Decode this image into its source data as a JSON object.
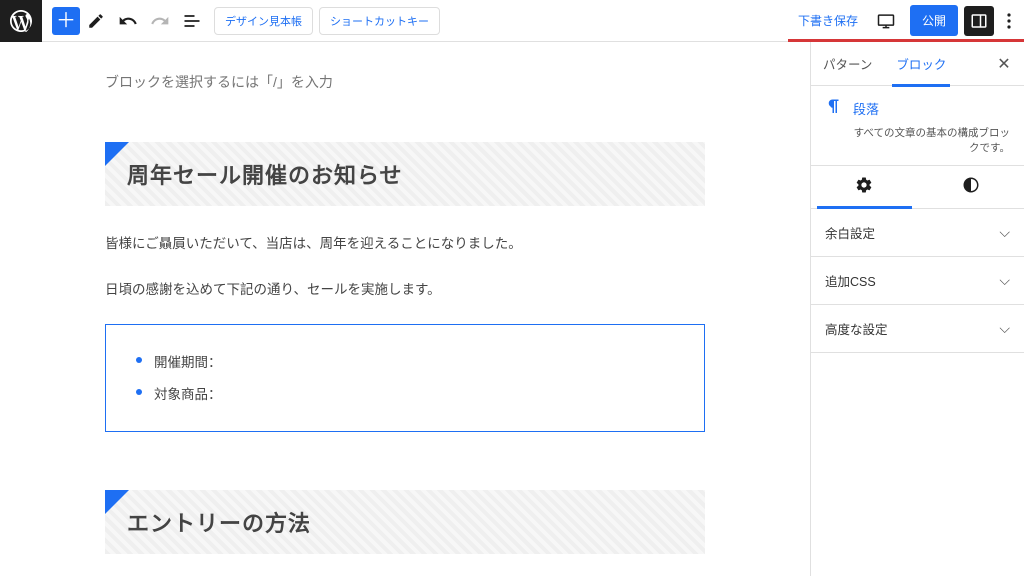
{
  "toolbar": {
    "design_button": "デザイン見本帳",
    "shortcut_button": "ショートカットキー",
    "draft_save": "下書き保存",
    "publish": "公開"
  },
  "editor": {
    "placeholder": "ブロックを選択するには「/」を入力",
    "heading1": "周年セール開催のお知らせ",
    "para1": "皆様にご贔屓いただいて、当店は、周年を迎えることになりました。",
    "para2": "日頃の感謝を込めて下記の通り、セールを実施します。",
    "list": [
      "開催期間：",
      "対象商品："
    ],
    "heading2": "エントリーの方法"
  },
  "sidebar": {
    "tabs": {
      "patterns": "パターン",
      "block": "ブロック"
    },
    "block_name": "段落",
    "block_desc": "すべての文章の基本の構成ブロックです。",
    "sections": {
      "margin": "余白設定",
      "additional_css": "追加CSS",
      "advanced": "高度な設定"
    }
  }
}
